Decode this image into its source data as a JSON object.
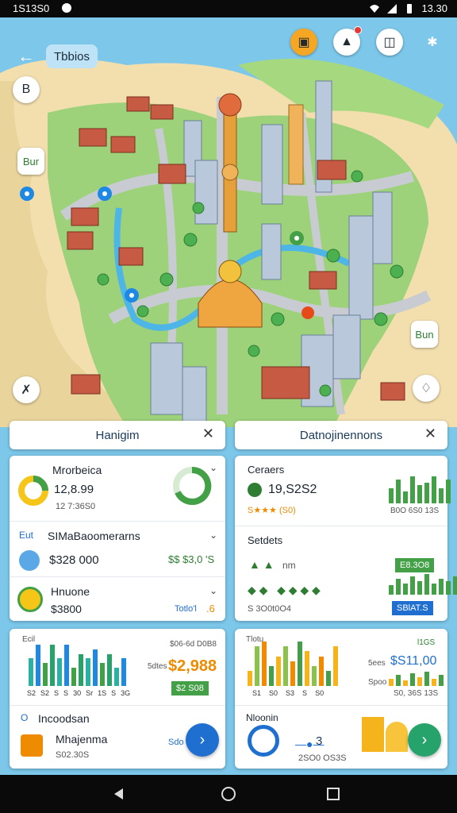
{
  "status_bar": {
    "time_left": "1S13S0",
    "time_right": "13.30"
  },
  "header": {
    "title": "Tbbios"
  },
  "icons": {
    "back": "back-arrow-icon",
    "book": "book-icon",
    "cart": "cart-icon",
    "doc": "document-icon",
    "more": "more-icon"
  },
  "map_side": {
    "left_top": "B",
    "left_mid": "Bur",
    "right_mid": "Bun"
  },
  "panels": {
    "left_tab": "Hanigim",
    "right_tab": "Datnojinennons"
  },
  "left_card": {
    "row1": {
      "title": "Mrorbeica",
      "value": "12,8.99",
      "sub": "12 7:36S0"
    },
    "row2": {
      "prefix": "Eut",
      "title": "SIMaBaoomerarns",
      "value": "$328 000",
      "right": "$$ $3,0 'S"
    },
    "row3": {
      "title": "Hnuone",
      "value": "$3800",
      "right": "Totlo'l",
      "right_num": ".6"
    }
  },
  "right_card": {
    "row1": {
      "title": "Ceraers",
      "value": "19,S2S2",
      "stars": "S★★★ (S0)",
      "footer": "B0O 6S0 13S"
    },
    "row2": {
      "title": "Setdets",
      "tag": "nm",
      "green_box": "E8.3O8",
      "blue_box": "SBlAT.S",
      "sub": "S 3O0t0O4"
    }
  },
  "left_bottom": {
    "label": "Ecil",
    "right_title": "$06-6d D0B8",
    "right_prefix": "5dtes",
    "amount": "$2,988",
    "green_box": "$2 S08",
    "x_labels": [
      "S2",
      "S2",
      "S",
      "S",
      "30",
      "Sr",
      "1S",
      "S",
      "3G"
    ]
  },
  "left_bottom2": {
    "prefix": "O",
    "title": "Incoodsan",
    "name": "Mhajenma",
    "sub": "S02.30S",
    "tag": "Sdo"
  },
  "right_bottom": {
    "label": "Tlotu",
    "right_title": "l1GS",
    "prefix": "5ees",
    "amount": "$S11,00",
    "sub_prefix": "Spoo",
    "footer": "S0, 36S 13S",
    "x_labels": [
      "S1",
      "S0",
      "S3",
      "S",
      "S0"
    ]
  },
  "right_bottom2": {
    "title": "Nloonin",
    "num": "3",
    "sub": "2SO0 OS3S"
  },
  "colors": {
    "accent_blue": "#1e6fd0",
    "accent_green": "#43a047",
    "water": "#7cc7ea"
  },
  "chart_data": [
    {
      "type": "bar",
      "values": [
        6,
        9,
        5,
        9,
        6,
        9,
        4,
        7,
        6,
        8,
        5,
        7,
        4,
        6
      ]
    },
    {
      "type": "bar",
      "values": [
        3,
        8,
        9,
        4,
        6,
        8,
        5,
        9,
        7,
        4,
        6,
        3,
        8
      ]
    }
  ]
}
